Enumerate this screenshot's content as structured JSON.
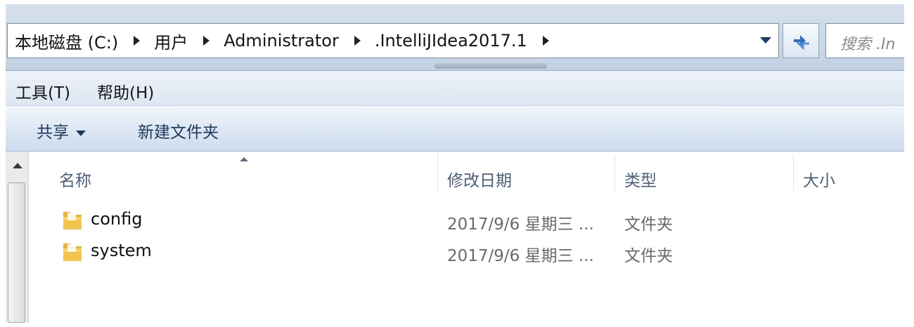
{
  "address_bar": {
    "crumbs": [
      "本地磁盘 (C:)",
      "用户",
      "Administrator",
      ".IntelliJIdea2017.1"
    ]
  },
  "search": {
    "placeholder": "搜索 .In"
  },
  "menu": {
    "items": [
      "工具(T)",
      "帮助(H)"
    ]
  },
  "toolbar": {
    "share_label": "共享",
    "new_folder_label": "新建文件夹"
  },
  "columns": [
    "名称",
    "修改日期",
    "类型",
    "大小"
  ],
  "files": [
    {
      "name": "config",
      "modified": "2017/9/6 星期三 ...",
      "type": "文件夹"
    },
    {
      "name": "system",
      "modified": "2017/9/6 星期三 ...",
      "type": "文件夹"
    }
  ],
  "colors": {
    "folder": "#f0c64e",
    "chrome": "#d0dcea",
    "header_text": "#4c607a"
  }
}
